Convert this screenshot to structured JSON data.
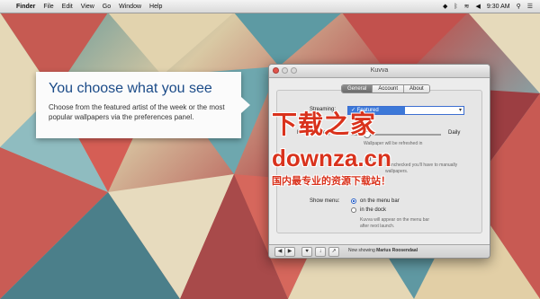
{
  "menubar": {
    "apple_glyph": "",
    "items": [
      "Finder",
      "File",
      "Edit",
      "View",
      "Go",
      "Window",
      "Help"
    ],
    "clock": "9:30 AM",
    "icons": [
      "dropbox-icon",
      "bluetooth-icon",
      "wifi-icon",
      "volume-icon",
      "spotlight-icon",
      "list-icon"
    ]
  },
  "callout": {
    "title": "You choose what you see",
    "body": "Choose from the featured artist of the week or the most popular wallpapers via the preferences panel."
  },
  "window": {
    "title": "Kuvva",
    "tabs": [
      "General",
      "Account",
      "About"
    ],
    "active_tab": "General",
    "streaming_label": "Streaming:",
    "streaming_selected": "✓ Featured",
    "refresh_label": "Refresh every:",
    "refresh_end_label": "Daily",
    "refresh_note": "Wallpaper will be refreshed in",
    "shuffle_note_line1": "If unchecked you'll have to manually",
    "shuffle_note_line2": "wallpapers.",
    "show_menu_label": "Show menu:",
    "show_menu_options": [
      "on the menu bar",
      "in the dock"
    ],
    "show_menu_selected": "on the menu bar",
    "show_menu_note_line1": "Kuvva will appear on the menu bar",
    "show_menu_note_line2": "after next launch.",
    "now_showing_prefix": "Now showing",
    "now_showing_artist": "Marius Roosendaal",
    "bottom_buttons": [
      "◀",
      "▶",
      "♥",
      "↓",
      "↗",
      "✎"
    ]
  },
  "watermark": {
    "line1": "下载之家",
    "line2": "downza.cn",
    "line3": "国内最专业的资源下载站！"
  },
  "colors": {
    "accent": "#3c78d8",
    "callout_title": "#1b4b88",
    "watermark": "#d9321c"
  }
}
